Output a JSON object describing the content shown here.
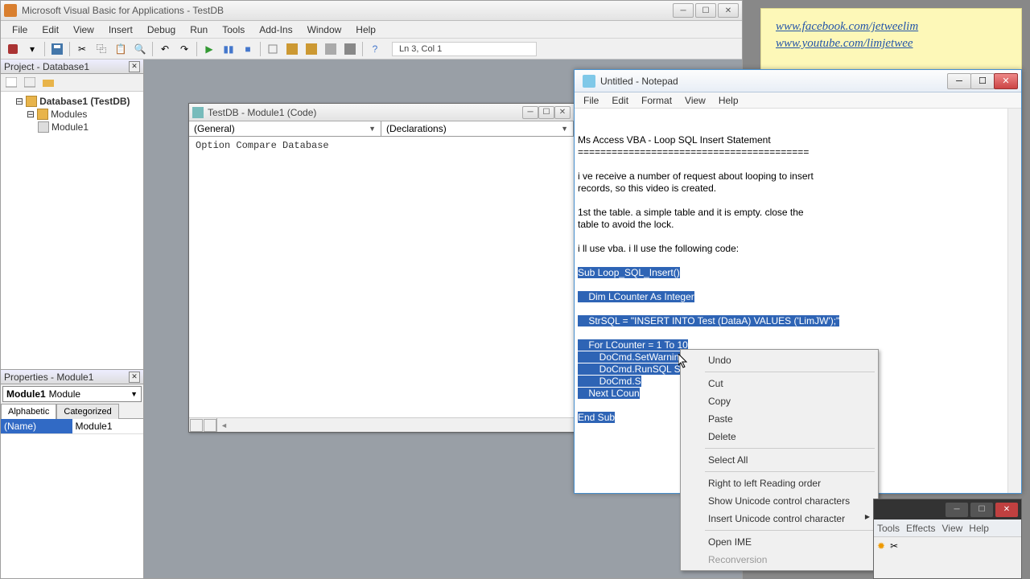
{
  "vba": {
    "title": "Microsoft Visual Basic for Applications - TestDB",
    "menu": [
      "File",
      "Edit",
      "View",
      "Insert",
      "Debug",
      "Run",
      "Tools",
      "Add-Ins",
      "Window",
      "Help"
    ],
    "cursor_pos": "Ln 3, Col 1",
    "project_panel_title": "Project - Database1",
    "tree": {
      "db": "Database1 (TestDB)",
      "modules": "Modules",
      "module1": "Module1"
    },
    "properties_panel_title": "Properties - Module1",
    "prop_combo_name": "Module1",
    "prop_combo_type": "Module",
    "prop_tabs": [
      "Alphabetic",
      "Categorized"
    ],
    "prop_name_key": "(Name)",
    "prop_name_val": "Module1",
    "code_window_title": "TestDB - Module1 (Code)",
    "code_combo_left": "(General)",
    "code_combo_right": "(Declarations)",
    "code_line": "Option Compare Database"
  },
  "notepad": {
    "title": "Untitled - Notepad",
    "menu": [
      "File",
      "Edit",
      "Format",
      "View",
      "Help"
    ],
    "plain_lines": [
      "Ms Access VBA - Loop SQL Insert Statement",
      "=========================================",
      "",
      "i ve receive a number of request about looping to insert",
      "records, so this video is created.",
      "",
      "1st the table. a simple table and it is empty. close the",
      "table to avoid the lock.",
      "",
      "i ll use vba. i ll use the following code:",
      ""
    ],
    "sel_lines": [
      "Sub Loop_SQL_Insert()",
      "",
      "    Dim LCounter As Integer",
      "",
      "    StrSQL = \"INSERT INTO Test (DataA) VALUES ('LimJW');\"",
      "",
      "    For LCounter = 1 To 10",
      "        DoCmd.SetWarnings False",
      "        DoCmd.RunSQL StrSQL",
      "        DoCmd.S",
      "    Next LCoun",
      "",
      "End Sub"
    ]
  },
  "context_menu": {
    "items": [
      "Undo",
      "Cut",
      "Copy",
      "Paste",
      "Delete",
      "Select All",
      "Right to left Reading order",
      "Show Unicode control characters",
      "Insert Unicode control character",
      "Open IME",
      "Reconversion"
    ]
  },
  "sticky": {
    "link1": "www.facebook.com/jetweelim",
    "link2": "www.youtube.com/limjetwee"
  },
  "partial": {
    "menu": [
      "Tools",
      "Effects",
      "View",
      "Help"
    ]
  }
}
